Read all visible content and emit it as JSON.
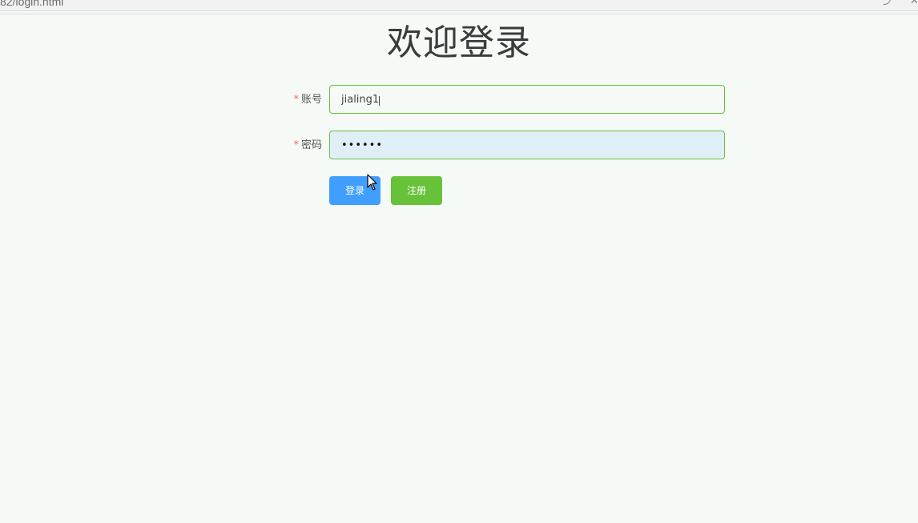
{
  "browser": {
    "url_fragment": "82/login.html",
    "share_icon": "share-icon",
    "extra_icon": "close-icon"
  },
  "page": {
    "title": "欢迎登录"
  },
  "form": {
    "account": {
      "label": "账号",
      "required_mark": "*",
      "value": "jialing1"
    },
    "password": {
      "label": "密码",
      "required_mark": "*",
      "value": "••••••"
    },
    "login_button": "登录",
    "register_button": "注册"
  },
  "colors": {
    "primary": "#409eff",
    "success": "#67c23a",
    "required": "#f56c6c",
    "background": "#f6faf7"
  }
}
